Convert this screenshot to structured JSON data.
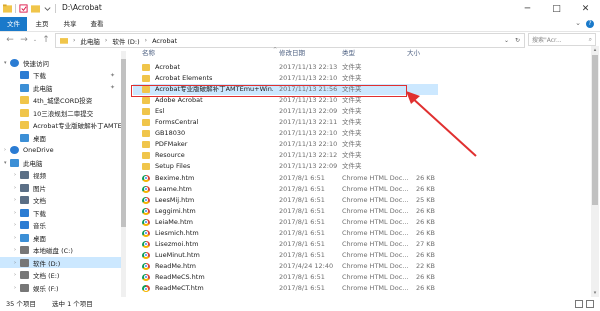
{
  "window": {
    "title": "D:\\Acrobat",
    "minimize": "─",
    "maximize": "□",
    "close": "✕"
  },
  "ribbon": {
    "tabs": [
      "文件",
      "主页",
      "共享",
      "查看"
    ],
    "help": "?"
  },
  "address": {
    "back": "←",
    "forward": "→",
    "up": "↑",
    "segments": [
      "此电脑",
      "软件 (D:)",
      "Acrobat"
    ],
    "search_placeholder": "搜索\"Acr...",
    "search_icon": "⌕"
  },
  "sidebar": {
    "items": [
      {
        "label": "快速访问",
        "icon": "star-icon",
        "color": "#2b7cd3",
        "indent": 0,
        "arrow": "▾",
        "selected": false,
        "pinned": false
      },
      {
        "label": "下载",
        "icon": "download-icon",
        "color": "#2b7cd3",
        "indent": 1,
        "arrow": "",
        "selected": false,
        "pinned": true
      },
      {
        "label": "此电脑",
        "icon": "pc-icon",
        "color": "#3c8fd6",
        "indent": 1,
        "arrow": "",
        "selected": false,
        "pinned": true
      },
      {
        "label": "4th_城堡CORD投资",
        "icon": "folder-icon",
        "color": "#f0c54a",
        "indent": 1,
        "arrow": "",
        "selected": false,
        "pinned": false
      },
      {
        "label": "10三浪规划二审提交",
        "icon": "folder-icon",
        "color": "#f0c54a",
        "indent": 1,
        "arrow": "",
        "selected": false,
        "pinned": false
      },
      {
        "label": "Acrobat专业版破解补丁AMTEm",
        "icon": "folder-icon",
        "color": "#f0c54a",
        "indent": 1,
        "arrow": "",
        "selected": false,
        "pinned": false
      },
      {
        "label": "桌面",
        "icon": "desktop-icon",
        "color": "#3c8fd6",
        "indent": 1,
        "arrow": "",
        "selected": false,
        "pinned": false
      },
      {
        "label": "OneDrive",
        "icon": "cloud-icon",
        "color": "#2b7cd3",
        "indent": 0,
        "arrow": "›",
        "selected": false,
        "pinned": false
      },
      {
        "label": "此电脑",
        "icon": "pc-icon",
        "color": "#3c8fd6",
        "indent": 0,
        "arrow": "▾",
        "selected": false,
        "pinned": false
      },
      {
        "label": "视频",
        "icon": "video-icon",
        "color": "#5b6f86",
        "indent": 1,
        "arrow": "›",
        "selected": false,
        "pinned": false
      },
      {
        "label": "图片",
        "icon": "picture-icon",
        "color": "#5b6f86",
        "indent": 1,
        "arrow": "›",
        "selected": false,
        "pinned": false
      },
      {
        "label": "文档",
        "icon": "document-icon",
        "color": "#5b6f86",
        "indent": 1,
        "arrow": "›",
        "selected": false,
        "pinned": false
      },
      {
        "label": "下载",
        "icon": "download-icon",
        "color": "#2b7cd3",
        "indent": 1,
        "arrow": "›",
        "selected": false,
        "pinned": false
      },
      {
        "label": "音乐",
        "icon": "music-icon",
        "color": "#2b7cd3",
        "indent": 1,
        "arrow": "›",
        "selected": false,
        "pinned": false
      },
      {
        "label": "桌面",
        "icon": "desktop-icon",
        "color": "#3c8fd6",
        "indent": 1,
        "arrow": "›",
        "selected": false,
        "pinned": false
      },
      {
        "label": "本地磁盘 (C:)",
        "icon": "drive-icon",
        "color": "#777777",
        "indent": 1,
        "arrow": "›",
        "selected": false,
        "pinned": false
      },
      {
        "label": "软件 (D:)",
        "icon": "drive-icon",
        "color": "#777777",
        "indent": 1,
        "arrow": "›",
        "selected": true,
        "pinned": false
      },
      {
        "label": "文档 (E:)",
        "icon": "drive-icon",
        "color": "#777777",
        "indent": 1,
        "arrow": "›",
        "selected": false,
        "pinned": false
      },
      {
        "label": "娱乐 (F:)",
        "icon": "drive-icon",
        "color": "#777777",
        "indent": 1,
        "arrow": "›",
        "selected": false,
        "pinned": false
      }
    ]
  },
  "columns": {
    "name": "名称",
    "date": "修改日期",
    "type": "类型",
    "size": "大小"
  },
  "files": [
    {
      "name": "Acrobat",
      "date": "2017/11/13 22:13",
      "type": "文件夹",
      "size": "",
      "icon": "folder-icon",
      "selected": false
    },
    {
      "name": "Acrobat Elements",
      "date": "2017/11/13 22:10",
      "type": "文件夹",
      "size": "",
      "icon": "folder-icon",
      "selected": false
    },
    {
      "name": "Acrobat专业版破解补丁AMTEmu+Win...",
      "date": "2017/11/13 21:56",
      "type": "文件夹",
      "size": "",
      "icon": "folder-icon",
      "selected": true
    },
    {
      "name": "Adobe Acrobat",
      "date": "2017/11/13 22:10",
      "type": "文件夹",
      "size": "",
      "icon": "folder-icon",
      "selected": false
    },
    {
      "name": "Esl",
      "date": "2017/11/13 22:09",
      "type": "文件夹",
      "size": "",
      "icon": "folder-icon",
      "selected": false
    },
    {
      "name": "FormsCentral",
      "date": "2017/11/13 22:11",
      "type": "文件夹",
      "size": "",
      "icon": "folder-icon",
      "selected": false
    },
    {
      "name": "GB18030",
      "date": "2017/11/13 22:10",
      "type": "文件夹",
      "size": "",
      "icon": "folder-icon",
      "selected": false
    },
    {
      "name": "PDFMaker",
      "date": "2017/11/13 22:10",
      "type": "文件夹",
      "size": "",
      "icon": "folder-icon",
      "selected": false
    },
    {
      "name": "Resource",
      "date": "2017/11/13 22:12",
      "type": "文件夹",
      "size": "",
      "icon": "folder-icon",
      "selected": false
    },
    {
      "name": "Setup Files",
      "date": "2017/11/13 22:09",
      "type": "文件夹",
      "size": "",
      "icon": "folder-icon",
      "selected": false
    },
    {
      "name": "Bexime.htm",
      "date": "2017/8/1 6:51",
      "type": "Chrome HTML Doc...",
      "size": "26 KB",
      "icon": "chrome-icon",
      "selected": false
    },
    {
      "name": "Leame.htm",
      "date": "2017/8/1 6:51",
      "type": "Chrome HTML Doc...",
      "size": "26 KB",
      "icon": "chrome-icon",
      "selected": false
    },
    {
      "name": "LeesMij.htm",
      "date": "2017/8/1 6:51",
      "type": "Chrome HTML Doc...",
      "size": "25 KB",
      "icon": "chrome-icon",
      "selected": false
    },
    {
      "name": "Leggimi.htm",
      "date": "2017/8/1 6:51",
      "type": "Chrome HTML Doc...",
      "size": "26 KB",
      "icon": "chrome-icon",
      "selected": false
    },
    {
      "name": "LeiaMe.htm",
      "date": "2017/8/1 6:51",
      "type": "Chrome HTML Doc...",
      "size": "26 KB",
      "icon": "chrome-icon",
      "selected": false
    },
    {
      "name": "Liesmich.htm",
      "date": "2017/8/1 6:51",
      "type": "Chrome HTML Doc...",
      "size": "26 KB",
      "icon": "chrome-icon",
      "selected": false
    },
    {
      "name": "Lisezmoi.htm",
      "date": "2017/8/1 6:51",
      "type": "Chrome HTML Doc...",
      "size": "27 KB",
      "icon": "chrome-icon",
      "selected": false
    },
    {
      "name": "LueMinut.htm",
      "date": "2017/8/1 6:51",
      "type": "Chrome HTML Doc...",
      "size": "26 KB",
      "icon": "chrome-icon",
      "selected": false
    },
    {
      "name": "ReadMe.htm",
      "date": "2017/4/24 12:40",
      "type": "Chrome HTML Doc...",
      "size": "22 KB",
      "icon": "chrome-icon",
      "selected": false
    },
    {
      "name": "ReadMeCS.htm",
      "date": "2017/8/1 6:51",
      "type": "Chrome HTML Doc...",
      "size": "26 KB",
      "icon": "chrome-icon",
      "selected": false
    },
    {
      "name": "ReadMeCT.htm",
      "date": "2017/8/1 6:51",
      "type": "Chrome HTML Doc...",
      "size": "26 KB",
      "icon": "chrome-icon",
      "selected": false
    }
  ],
  "status": {
    "count": "35 个项目",
    "selected": "选中 1 个项目"
  },
  "colors": {
    "accent": "#1979ca",
    "selection": "#cce8ff",
    "annotation": "#e03030"
  }
}
